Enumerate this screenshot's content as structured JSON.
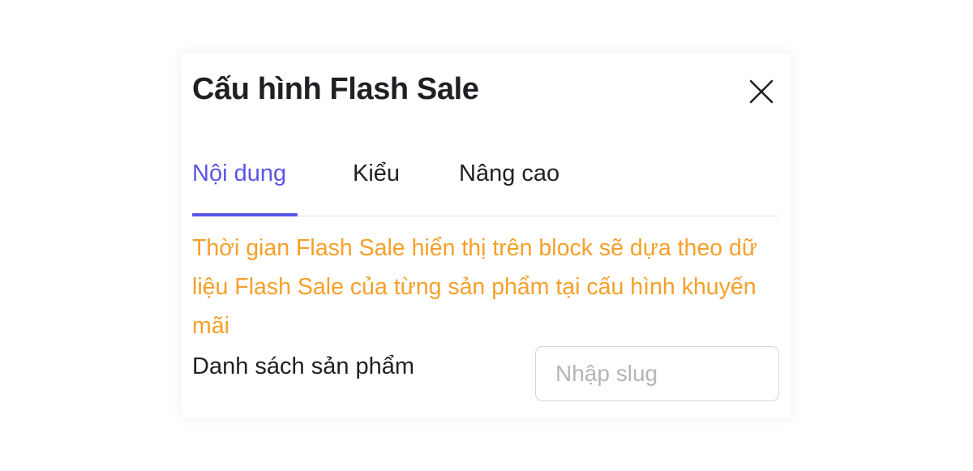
{
  "dialog": {
    "title": "Cấu hình Flash Sale",
    "close_icon": "close-icon"
  },
  "tabs": [
    {
      "label": "Nội dung",
      "active": true
    },
    {
      "label": "Kiểu",
      "active": false
    },
    {
      "label": "Nâng cao",
      "active": false
    }
  ],
  "notice": {
    "text": "Thời gian Flash Sale hiển thị trên block sẽ dựa theo dữ liệu Flash Sale của từng sản phẩm tại cấu hình khuyến mãi",
    "color": "#f5a02a"
  },
  "product_list": {
    "label": "Danh sách sản phẩm",
    "value": "",
    "placeholder": "Nhập slug"
  },
  "colors": {
    "accent": "#5b55e6",
    "warning": "#f5a02a",
    "text": "#1f1f24"
  }
}
